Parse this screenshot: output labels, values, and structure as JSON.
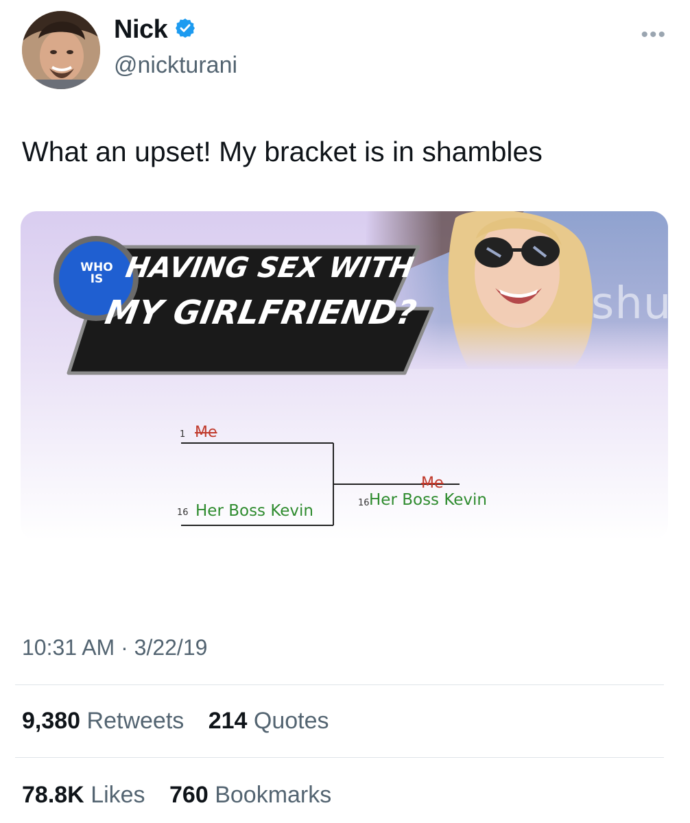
{
  "author": {
    "name": "Nick",
    "handle": "@nickturani",
    "verified_badge": "verified-badge-icon",
    "badge_color": "#1d9bf0"
  },
  "tweet": {
    "text": "What an upset! My bracket is in shambles",
    "timestamp": "10:31 AM · 3/22/19"
  },
  "media": {
    "banner_who": "WHO",
    "banner_is": "IS",
    "banner_line1": "HAVING SEX WITH",
    "banner_line2": "MY GIRLFRIEND?",
    "watermark": "shu",
    "bracket": {
      "seed1": "1",
      "entry1": "Me",
      "seed2": "16",
      "entry2": "Her Boss Kevin",
      "result_loser": "Me",
      "result_seed": "16",
      "result_winner": "Her Boss Kevin"
    }
  },
  "stats": {
    "retweets_count": "9,380",
    "retweets_label": "Retweets",
    "quotes_count": "214",
    "quotes_label": "Quotes",
    "likes_count": "78.8K",
    "likes_label": "Likes",
    "bookmarks_count": "760",
    "bookmarks_label": "Bookmarks"
  },
  "more_menu": "more-options-icon"
}
